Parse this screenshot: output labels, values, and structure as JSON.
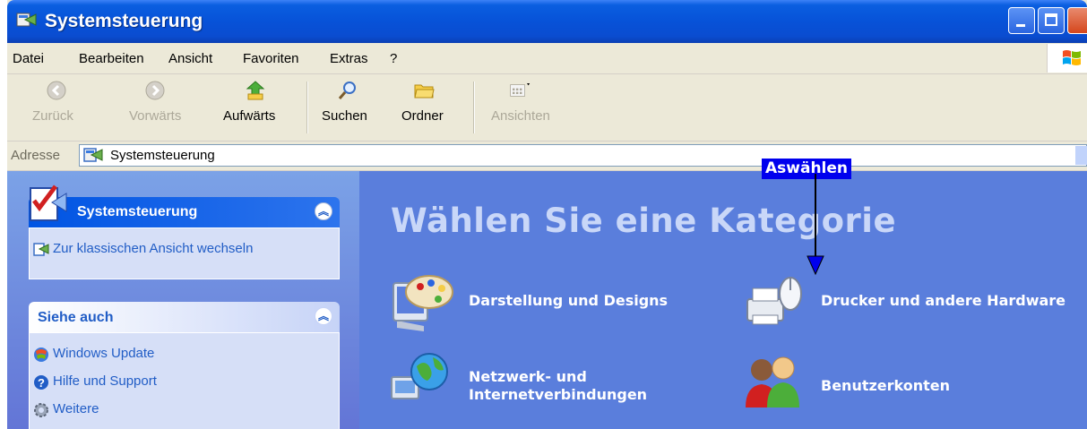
{
  "window": {
    "title": "Systemsteuerung"
  },
  "menu": [
    "Datei",
    "Bearbeiten",
    "Ansicht",
    "Favoriten",
    "Extras",
    "?"
  ],
  "toolbar": {
    "back": "Zurück",
    "forward": "Vorwärts",
    "up": "Aufwärts",
    "search": "Suchen",
    "folders": "Ordner",
    "views": "Ansichten"
  },
  "address": {
    "label": "Adresse",
    "value": "Systemsteuerung"
  },
  "sidebar": {
    "panel1": {
      "title": "Systemsteuerung",
      "link": "Zur klassischen Ansicht wechseln"
    },
    "panel2": {
      "title": "Siehe auch",
      "links": [
        "Windows Update",
        "Hilfe und Support",
        "Weitere"
      ]
    }
  },
  "main": {
    "heading": "Wählen Sie eine Kategorie",
    "categories": [
      {
        "label": "Darstellung und Designs"
      },
      {
        "label": "Drucker und andere Hardware"
      },
      {
        "line1": "Netzwerk- und",
        "line2": "Internetverbindungen"
      },
      {
        "label": "Benutzerkonten"
      }
    ]
  },
  "annotation": {
    "label": "Aswählen"
  },
  "colors": {
    "titlebar": "#0a5ee0",
    "sidebar": "#7ba2e7",
    "main": "#5a7edc",
    "annotation": "#0000ee"
  }
}
